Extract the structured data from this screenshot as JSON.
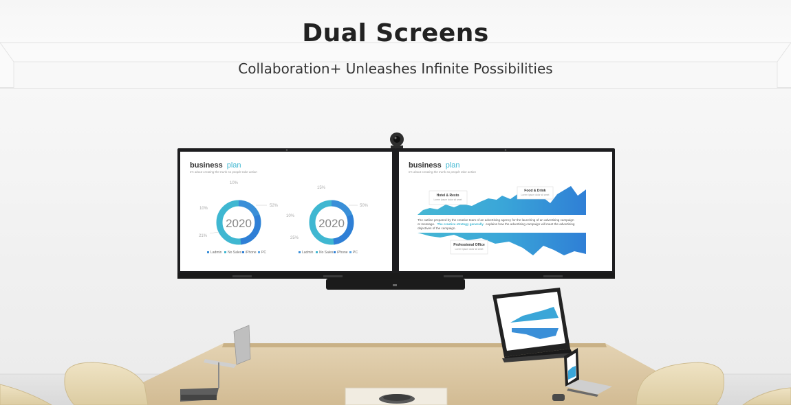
{
  "hero": {
    "title": "Dual Screens",
    "subtitle": "Collaboration+ Unleashes Infinite Possibilities"
  },
  "left_screen": {
    "heading_word1": "business",
    "heading_word2": "plan",
    "tagline": "It's about creating the trunk so people take action",
    "donuts": [
      {
        "center_label": "2020",
        "callouts": [
          "10%",
          "10%",
          "52%",
          "21%"
        ],
        "legend": [
          "Ladmin",
          "No Sales",
          "iPhone",
          "PC"
        ]
      },
      {
        "center_label": "2020",
        "callouts": [
          "15%",
          "10%",
          "50%",
          "25%"
        ],
        "legend": [
          "Ladmin",
          "No Sales",
          "iPhone",
          "PC"
        ]
      }
    ]
  },
  "right_screen": {
    "heading_word1": "business",
    "heading_word2": "plan",
    "tagline": "It's about creating the trunk so people take action",
    "callouts": [
      {
        "title": "Hotel & Resto",
        "body": "Lorem ipsum dolor sit amet"
      },
      {
        "title": "Food & Drink",
        "body": "Lorem ipsum dolor sit amet"
      },
      {
        "title": "Professional Office",
        "body": "Lorem ipsum dolor sit amet"
      }
    ],
    "paragraph_line1": "The outline prepared by the creative team of an advertising agency for the launching of an advertising campaign",
    "paragraph_line2_prefix": "or message.",
    "paragraph_highlight": "The creative strategy generally",
    "paragraph_line2_suffix": "explains how the advertising campaign will meet the advertising",
    "paragraph_line3": "objectives of the campaign."
  },
  "colors": {
    "accent_blue": "#3a8fd8",
    "accent_teal": "#3fb7d1",
    "dark_text": "#222222",
    "wood": "#dcc8a5"
  }
}
